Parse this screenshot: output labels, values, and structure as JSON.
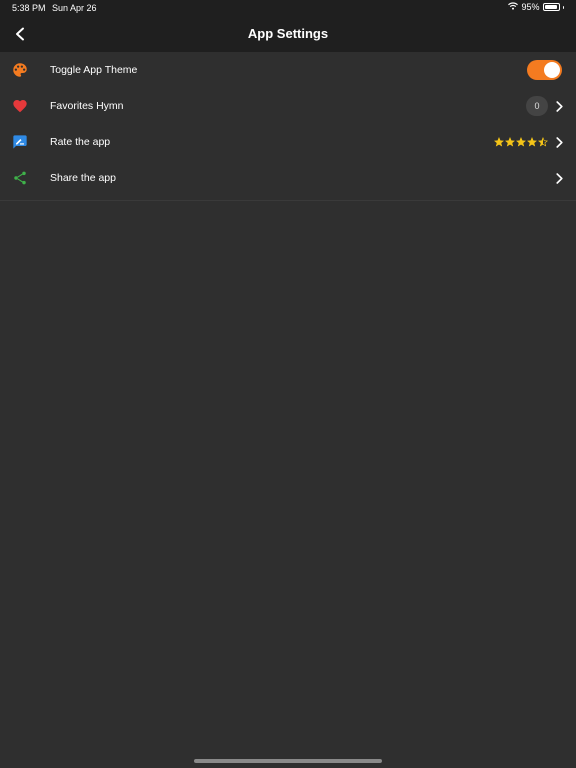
{
  "status_bar": {
    "time": "5:38 PM",
    "date": "Sun Apr 26",
    "battery": "95%",
    "battery_level": 0.95
  },
  "header": {
    "title": "App Settings",
    "back_icon": "chevron-left-icon"
  },
  "settings": [
    {
      "label": "Toggle App Theme",
      "icon": "palette-icon",
      "icon_color": "#f47b20",
      "control": "toggle",
      "toggle_on": true,
      "toggle_color": "#f47b20"
    },
    {
      "label": "Favorites Hymn",
      "icon": "heart-icon",
      "icon_color": "#e5393b",
      "control": "badge",
      "badge_value": "0"
    },
    {
      "label": "Rate the app",
      "icon": "rate-review-icon",
      "icon_color": "#2f8ae5",
      "control": "stars",
      "rating": 4.5,
      "rating_max": 5,
      "star_color": "#f5c518"
    },
    {
      "label": "Share the app",
      "icon": "share-icon",
      "icon_color": "#3fb24a",
      "control": "chevron"
    }
  ]
}
